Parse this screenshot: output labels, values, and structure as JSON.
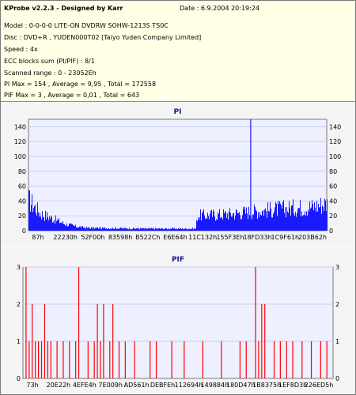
{
  "info": {
    "title": "KProbe v2.2.3 - Designed by Karr",
    "date": "Date : 6.9.2004 20:19:24",
    "lines": [
      "Model : 0-0-0-0 LITE-ON DVDRW SOHW-1213S TS0C",
      "Disc : DVD+R , YUDEN000T02 [Taiyo Yuden Company Limited]",
      "Speed : 4x",
      "ECC blocks sum (PI/PIF) : 8/1",
      "Scanned range : 0 - 23052Eh",
      "PI Max = 154 , Average = 9,95 , Total = 172558",
      "PIF Max = 3 , Average = 0,01 , Total = 643"
    ]
  },
  "charts": {
    "pi": {
      "title": "PI",
      "color": "#1a1aff",
      "ymax": 150,
      "yticks": [
        "140",
        "120",
        "100",
        "80",
        "60",
        "40",
        "20",
        "0"
      ],
      "xticks": [
        "87h",
        "22230h",
        "52F00h",
        "83598h",
        "B522Ch",
        "E6E64h",
        "11C132h",
        "155F3Eh",
        "18FD33h",
        "1C9F61h",
        "203B62h"
      ]
    },
    "pif": {
      "title": "PIF",
      "color": "#ff0000",
      "ymax": 3,
      "yticks": [
        "3",
        "2",
        "1",
        "0"
      ],
      "xticks": [
        "73h",
        "20E22h",
        "4EFE4h",
        "7E009h",
        "AD561h",
        "DEBFEh",
        "112694h",
        "149884h",
        "180D47h",
        "1B8375h",
        "1EF8D3h",
        "226ED5h"
      ]
    }
  },
  "chart_data": [
    {
      "type": "bar",
      "title": "PI",
      "ylim": [
        0,
        150
      ],
      "yticks": [
        0,
        20,
        40,
        60,
        80,
        100,
        120,
        140
      ],
      "profile": [
        {
          "x": 0.0,
          "y": 45
        },
        {
          "x": 0.04,
          "y": 25
        },
        {
          "x": 0.08,
          "y": 18
        },
        {
          "x": 0.12,
          "y": 10
        },
        {
          "x": 0.16,
          "y": 6
        },
        {
          "x": 0.2,
          "y": 4
        },
        {
          "x": 0.4,
          "y": 3
        },
        {
          "x": 0.56,
          "y": 3
        },
        {
          "x": 0.565,
          "y": 22
        },
        {
          "x": 0.66,
          "y": 24
        },
        {
          "x": 0.75,
          "y": 28
        },
        {
          "x": 0.85,
          "y": 32
        },
        {
          "x": 0.95,
          "y": 35
        },
        {
          "x": 1.0,
          "y": 40
        }
      ],
      "spikes": [
        {
          "x": 0.745,
          "y": 154
        }
      ],
      "series": [
        {
          "name": "PI"
        }
      ]
    },
    {
      "type": "bar",
      "title": "PIF",
      "ylim": [
        0,
        3
      ],
      "yticks": [
        0,
        1,
        2,
        3
      ],
      "spikes": [
        {
          "x": 0.01,
          "y": 3
        },
        {
          "x": 0.02,
          "y": 1
        },
        {
          "x": 0.03,
          "y": 2
        },
        {
          "x": 0.04,
          "y": 1
        },
        {
          "x": 0.05,
          "y": 1
        },
        {
          "x": 0.06,
          "y": 1
        },
        {
          "x": 0.07,
          "y": 2
        },
        {
          "x": 0.08,
          "y": 1
        },
        {
          "x": 0.09,
          "y": 1
        },
        {
          "x": 0.11,
          "y": 1
        },
        {
          "x": 0.13,
          "y": 1
        },
        {
          "x": 0.15,
          "y": 1
        },
        {
          "x": 0.17,
          "y": 1
        },
        {
          "x": 0.18,
          "y": 3
        },
        {
          "x": 0.21,
          "y": 1
        },
        {
          "x": 0.23,
          "y": 1
        },
        {
          "x": 0.24,
          "y": 2
        },
        {
          "x": 0.25,
          "y": 1
        },
        {
          "x": 0.26,
          "y": 2
        },
        {
          "x": 0.28,
          "y": 1
        },
        {
          "x": 0.29,
          "y": 2
        },
        {
          "x": 0.31,
          "y": 1
        },
        {
          "x": 0.33,
          "y": 1
        },
        {
          "x": 0.36,
          "y": 1
        },
        {
          "x": 0.41,
          "y": 1
        },
        {
          "x": 0.43,
          "y": 1
        },
        {
          "x": 0.48,
          "y": 1
        },
        {
          "x": 0.52,
          "y": 1
        },
        {
          "x": 0.58,
          "y": 1
        },
        {
          "x": 0.64,
          "y": 1
        },
        {
          "x": 0.7,
          "y": 1
        },
        {
          "x": 0.72,
          "y": 1
        },
        {
          "x": 0.75,
          "y": 3
        },
        {
          "x": 0.76,
          "y": 1
        },
        {
          "x": 0.77,
          "y": 2
        },
        {
          "x": 0.78,
          "y": 2
        },
        {
          "x": 0.81,
          "y": 1
        },
        {
          "x": 0.83,
          "y": 1
        },
        {
          "x": 0.85,
          "y": 1
        },
        {
          "x": 0.87,
          "y": 1
        },
        {
          "x": 0.9,
          "y": 1
        },
        {
          "x": 0.93,
          "y": 1
        },
        {
          "x": 0.96,
          "y": 1
        },
        {
          "x": 0.98,
          "y": 1
        }
      ],
      "series": [
        {
          "name": "PIF"
        }
      ]
    }
  ]
}
